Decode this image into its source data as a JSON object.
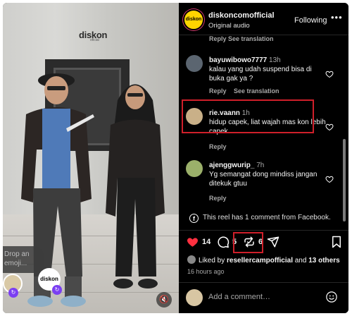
{
  "video": {
    "brand": "diskon",
    "brand_sub": "oficial",
    "emoji_prompt": "Drop an emoji...",
    "float_logo": "diskon",
    "badge_icon": "repost-icon",
    "mute_icon": "muted-speaker-icon"
  },
  "header": {
    "avatar_text": "diskon",
    "account": "diskoncomofficial",
    "subtitle": "Original audio",
    "follow_label": "Following",
    "more_icon": "•••"
  },
  "comments": {
    "prev_actions": "Reply  See translation",
    "items": [
      {
        "user": "bayuwibowo7777",
        "time": "13h",
        "text": "kalau yang udah suspend bisa di buka gak ya ?",
        "reply": "Reply",
        "translate": "See translation"
      },
      {
        "user": "rie.vaann",
        "time": "1h",
        "text": "hidup capek, liat wajah mas kon lebih capek",
        "reply": "Reply"
      },
      {
        "user": "ajenggwurip_",
        "time": "7h",
        "text": "Yg semangat dong mindiss jangan ditekuk gtuu",
        "reply": "Reply"
      }
    ],
    "facebook_note": "This reel has 1 comment from Facebook."
  },
  "actions": {
    "like_count": "14",
    "comment_count": "5",
    "repost_count": "6",
    "like_color": "#ff3040"
  },
  "likes": {
    "prefix": "Liked by",
    "user": "resellercampofficial",
    "and": "and",
    "others": "13 others"
  },
  "posted_ago": "16 hours ago",
  "add_comment": {
    "placeholder": "Add a comment…"
  }
}
